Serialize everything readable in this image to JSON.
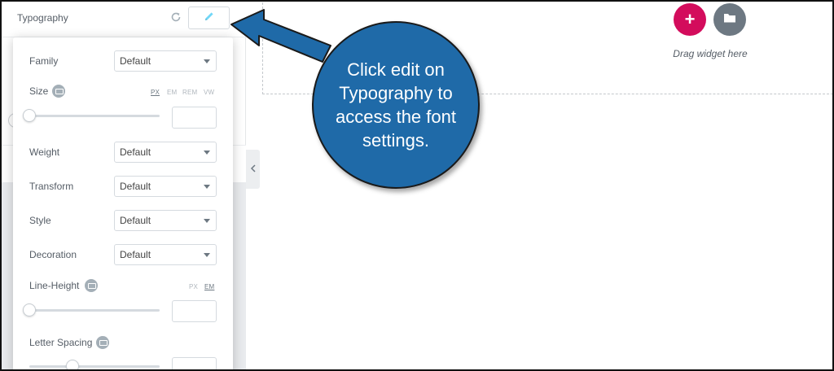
{
  "panel": {
    "typography_label": "Typography",
    "reset_icon": "reset-icon",
    "edit_icon": "pencil-icon"
  },
  "popover": {
    "family": {
      "label": "Family",
      "value": "Default"
    },
    "size": {
      "label": "Size",
      "units": [
        "PX",
        "EM",
        "REM",
        "VW"
      ],
      "active_unit": "PX",
      "value": ""
    },
    "weight": {
      "label": "Weight",
      "value": "Default"
    },
    "transform": {
      "label": "Transform",
      "value": "Default"
    },
    "style": {
      "label": "Style",
      "value": "Default"
    },
    "decoration": {
      "label": "Decoration",
      "value": "Default"
    },
    "line_height": {
      "label": "Line-Height",
      "units": [
        "PX",
        "EM"
      ],
      "active_unit": "EM",
      "value": ""
    },
    "letter_spacing": {
      "label": "Letter Spacing",
      "value": ""
    }
  },
  "canvas": {
    "add_icon": "+",
    "template_icon": "folder-icon",
    "drag_text": "Drag widget here",
    "collapse_icon": "chevron-left-icon"
  },
  "callout": {
    "text": "Click edit on Typography to access the font settings."
  },
  "colors": {
    "accent_pink": "#d30c5c",
    "callout_blue": "#1f6aa8",
    "gray_button": "#6d7882"
  }
}
